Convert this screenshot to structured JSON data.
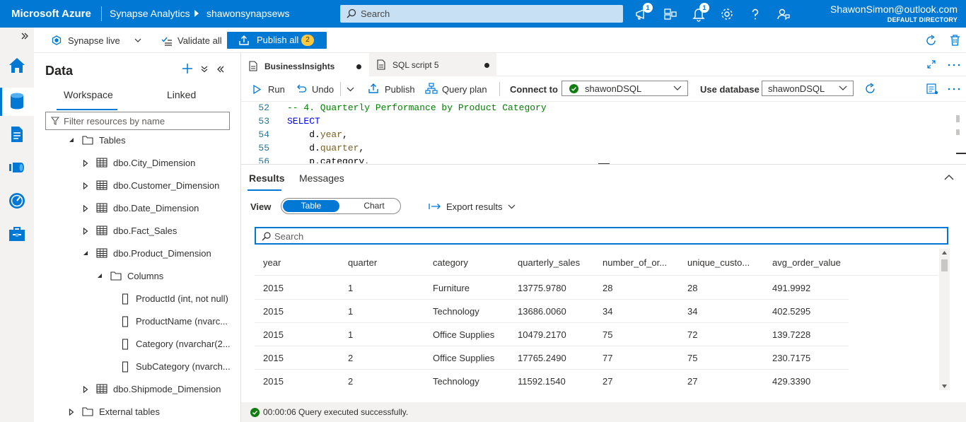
{
  "topbar": {
    "brand": "Microsoft Azure",
    "product": "Synapse Analytics",
    "workspace": "shawonsynapsews",
    "search_placeholder": "Search",
    "notifications_badge": "1",
    "alerts_badge": "1",
    "user_email": "ShawonSimon@outlook.com",
    "user_directory": "DEFAULT DIRECTORY"
  },
  "toolbar1": {
    "synapse_live": "Synapse live",
    "validate_all": "Validate all",
    "publish_all": "Publish all",
    "publish_count": "2"
  },
  "data_panel": {
    "title": "Data",
    "tabs": [
      {
        "label": "Workspace",
        "active": true
      },
      {
        "label": "Linked",
        "active": false
      }
    ],
    "filter_placeholder": "Filter resources by name",
    "tree": [
      {
        "label": "Tables",
        "type": "folder",
        "expanded": true,
        "indent": 0
      },
      {
        "label": "dbo.City_Dimension",
        "type": "table",
        "expanded": false,
        "indent": 1
      },
      {
        "label": "dbo.Customer_Dimension",
        "type": "table",
        "expanded": false,
        "indent": 1
      },
      {
        "label": "dbo.Date_Dimension",
        "type": "table",
        "expanded": false,
        "indent": 1
      },
      {
        "label": "dbo.Fact_Sales",
        "type": "table",
        "expanded": false,
        "indent": 1
      },
      {
        "label": "dbo.Product_Dimension",
        "type": "table",
        "expanded": true,
        "indent": 1
      },
      {
        "label": "Columns",
        "type": "folder",
        "expanded": true,
        "indent": 2
      },
      {
        "label": "ProductId (int, not null)",
        "type": "column",
        "indent": 3
      },
      {
        "label": "ProductName (nvarc...",
        "type": "column",
        "indent": 3
      },
      {
        "label": "Category (nvarchar(2...",
        "type": "column",
        "indent": 3
      },
      {
        "label": "SubCategory (nvarch...",
        "type": "column",
        "indent": 3
      },
      {
        "label": "dbo.Shipmode_Dimension",
        "type": "table",
        "expanded": false,
        "indent": 1
      },
      {
        "label": "External tables",
        "type": "folder",
        "expanded": false,
        "indent": 0
      }
    ]
  },
  "editor": {
    "tabs": [
      {
        "label": "BusinessInsights",
        "active": true,
        "unsaved": true
      },
      {
        "label": "SQL script 5",
        "active": false,
        "unsaved": true
      }
    ],
    "toolbar": {
      "run": "Run",
      "undo": "Undo",
      "publish": "Publish",
      "query_plan": "Query plan",
      "connect_to_label": "Connect to",
      "connect_to_value": "shawonDSQL",
      "use_database_label": "Use database",
      "use_database_value": "shawonDSQL"
    },
    "code_lines": [
      {
        "num": "52",
        "parts": [
          {
            "t": "-- 4. Quarterly Performance by Product Category",
            "c": "cm"
          }
        ]
      },
      {
        "num": "53",
        "parts": [
          {
            "t": "SELECT",
            "c": "kw"
          }
        ]
      },
      {
        "num": "54",
        "parts": [
          {
            "t": "    d.",
            "c": "pl"
          },
          {
            "t": "year",
            "c": "fld"
          },
          {
            "t": ",",
            "c": "pl"
          }
        ]
      },
      {
        "num": "55",
        "parts": [
          {
            "t": "    d.",
            "c": "pl"
          },
          {
            "t": "quarter",
            "c": "fld"
          },
          {
            "t": ",",
            "c": "pl"
          }
        ]
      },
      {
        "num": "56",
        "parts": [
          {
            "t": "    p.category,",
            "c": "pl"
          }
        ]
      }
    ]
  },
  "results": {
    "tabs": [
      {
        "label": "Results",
        "active": true
      },
      {
        "label": "Messages",
        "active": false
      }
    ],
    "view_label": "View",
    "view_options": [
      "Table",
      "Chart"
    ],
    "export_label": "Export results",
    "search_placeholder": "Search",
    "columns": [
      "year",
      "quarter",
      "category",
      "quarterly_sales",
      "number_of_or...",
      "unique_custo...",
      "avg_order_value"
    ],
    "rows": [
      [
        "2015",
        "1",
        "Furniture",
        "13775.9780",
        "28",
        "28",
        "491.9992"
      ],
      [
        "2015",
        "1",
        "Technology",
        "13686.0060",
        "34",
        "34",
        "402.5295"
      ],
      [
        "2015",
        "1",
        "Office Supplies",
        "10479.2170",
        "75",
        "72",
        "139.7228"
      ],
      [
        "2015",
        "2",
        "Office Supplies",
        "17765.2490",
        "77",
        "75",
        "230.7175"
      ],
      [
        "2015",
        "2",
        "Technology",
        "11592.1540",
        "27",
        "27",
        "429.3390"
      ]
    ],
    "status": "00:00:06 Query executed successfully."
  },
  "colors": {
    "azure_blue": "#0078d4",
    "success_green": "#107c10",
    "badge_yellow": "#ffc83d"
  }
}
